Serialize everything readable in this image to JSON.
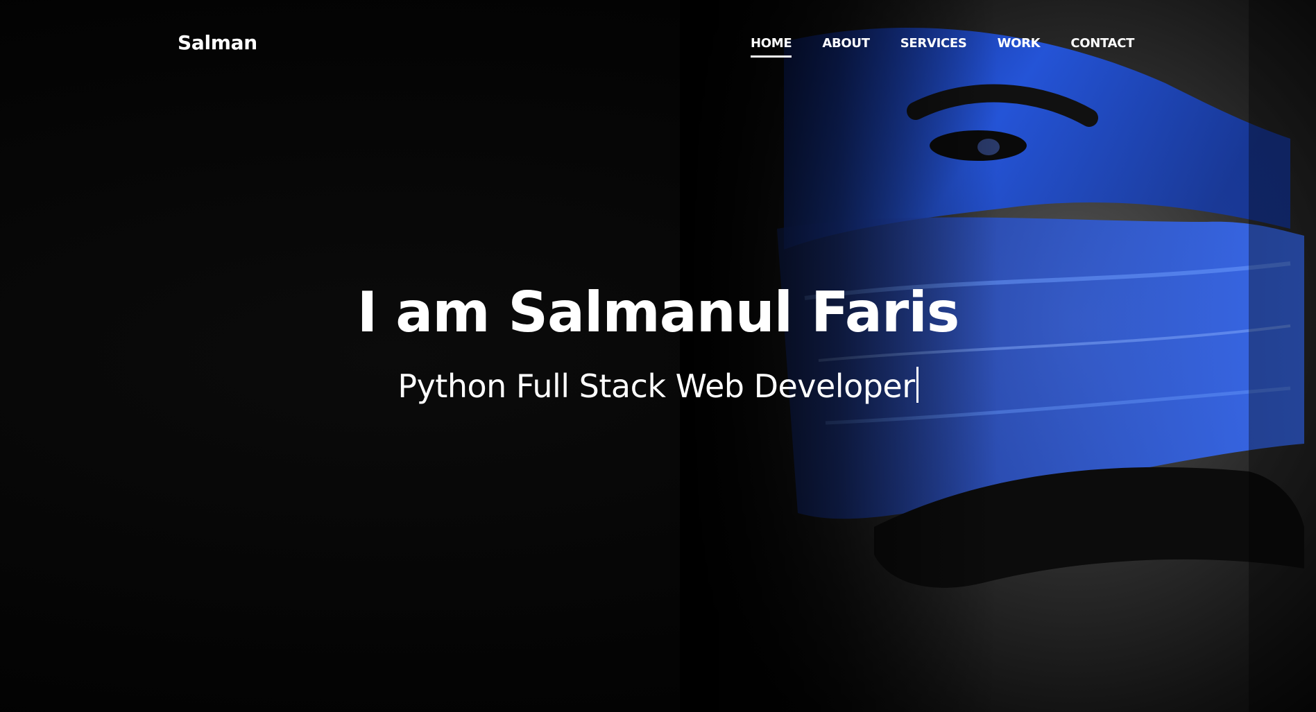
{
  "brand": "Salman",
  "nav": {
    "items": [
      {
        "label": "HOME",
        "active": true
      },
      {
        "label": "ABOUT",
        "active": false
      },
      {
        "label": "SERVICES",
        "active": false
      },
      {
        "label": "WORK",
        "active": false
      },
      {
        "label": "CONTACT",
        "active": false
      }
    ]
  },
  "hero": {
    "headline": "I am Salmanul Faris",
    "subtitle": "Python Full Stack Web Developer"
  },
  "colors": {
    "background": "#000000",
    "text": "#ffffff",
    "paint_accent": "#1f4fd8"
  }
}
